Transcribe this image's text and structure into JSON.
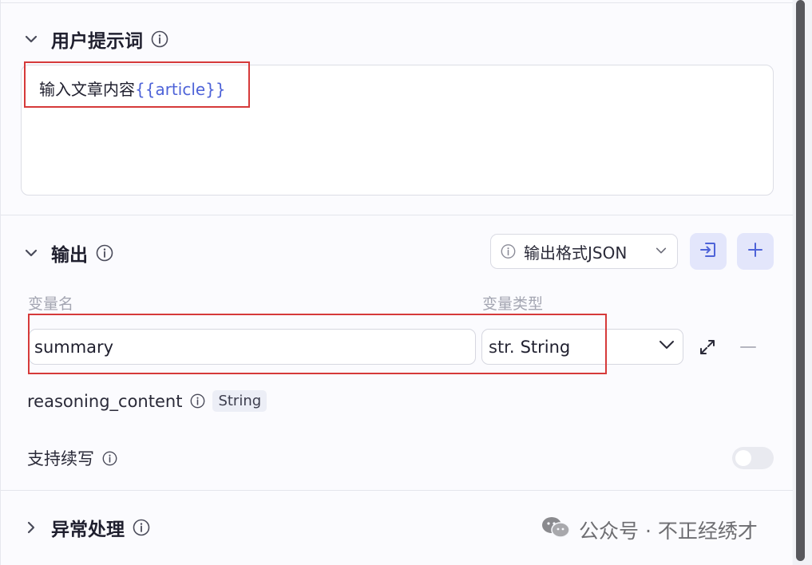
{
  "prompt_section": {
    "title": "用户提示词",
    "content_text": "输入文章内容",
    "content_variable": "{{article}}"
  },
  "output_section": {
    "title": "输出",
    "format_select": {
      "value": "输出格式JSON"
    },
    "columns": {
      "name": "变量名",
      "type": "变量类型"
    },
    "variable": {
      "name": "summary",
      "type_prefix": "str.",
      "type": "String"
    },
    "reasoning": {
      "name": "reasoning_content",
      "type": "String"
    },
    "continue_label": "支持续写"
  },
  "error_section": {
    "title": "异常处理"
  },
  "watermark": {
    "text": "公众号 · 不正经绣才"
  },
  "colors": {
    "accent": "#4e63d8",
    "highlight": "#d63a3a",
    "button_bg": "#e3e6fb"
  }
}
